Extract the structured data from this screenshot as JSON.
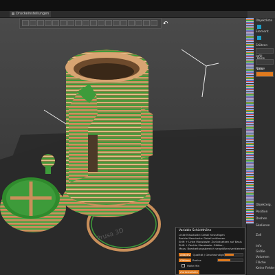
{
  "tabs": [
    {
      "label": "Druckeinstellungen",
      "active": false
    }
  ],
  "toolbar": {
    "buttons": [
      "move-icon",
      "scale-icon",
      "rotate-icon",
      "place-icon",
      "cut-icon",
      "paint-icon",
      "seam-icon",
      "support-icon",
      "measure-icon",
      "arrange-icon",
      "copy-icon",
      "delete-icon",
      "split-icon",
      "slice-icon",
      "layers-icon",
      "view-icon",
      "zoom-icon",
      "grid-icon"
    ],
    "undo_icon": "undo-icon"
  },
  "bed": {
    "logo_text": "Prusa 3D"
  },
  "sidepanel": {
    "labels": [
      "Objektliste",
      "Element",
      "Stützen",
      "Infill",
      "Name",
      "Objekteig.",
      "Position",
      "Drehen",
      "Skalieren",
      "Zoll",
      "Info",
      "Größe",
      "Volumen",
      "Fläche",
      "Keine Fehler"
    ],
    "value_25": "25%",
    "value_kein": "Keine"
  },
  "mouse_panel": {
    "title": "Variable Schichthöhe",
    "lines": [
      "Linke Maustaste: Detail hinzufügen",
      "Rechte Maustaste: Detail entfernen",
      "Shift + Linke Maustaste: Zurücksetzen auf Basis",
      "Shift + Rechte Maustaste: Glätten",
      "Maus: Bearbeitungsbereich vergrößern/verkleinern"
    ],
    "rows": [
      {
        "badge": "Adaptiv",
        "label": "Qualität / Geschwindigkeit",
        "value": 0.5
      },
      {
        "badge": "Glätten",
        "label": "Radius",
        "value": 0.5
      }
    ],
    "keep_min": "Halte Min",
    "reset_label": "Zurücksetzen"
  },
  "colors": {
    "accent": "#e07a1e",
    "bed": "#2c2c2c",
    "stripe_green": "#3d9b3a",
    "stripe_tan": "#c98f5a"
  }
}
